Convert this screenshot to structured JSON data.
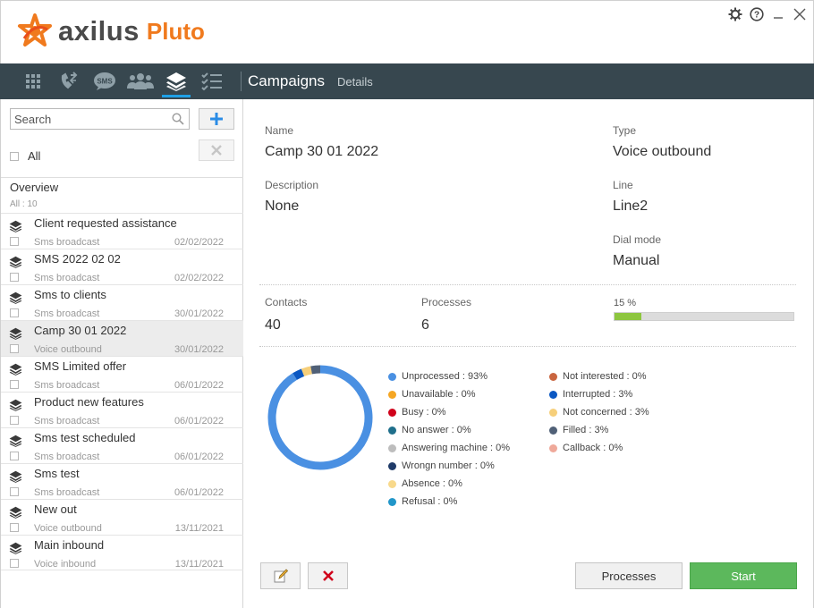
{
  "app": {
    "brand": "axilus",
    "product": "Pluto",
    "colors": {
      "brand_orange": "#f07a1e",
      "toolbar_bg": "#37474f",
      "accent_blue": "#1ea0e6",
      "start_green": "#5cb85c"
    }
  },
  "window_controls": [
    {
      "icon": "gear-icon"
    },
    {
      "icon": "help-icon"
    },
    {
      "icon": "minimize-icon"
    },
    {
      "icon": "close-icon"
    }
  ],
  "toolbar": {
    "tools": [
      {
        "icon": "grid-icon"
      },
      {
        "icon": "call-transfer-icon"
      },
      {
        "icon": "sms-icon"
      },
      {
        "icon": "users-icon"
      },
      {
        "icon": "layers-icon",
        "active": true
      },
      {
        "icon": "checklist-icon"
      }
    ],
    "title": "Campaigns",
    "subtitle": "Details"
  },
  "sidebar": {
    "search_placeholder": "Search",
    "all_label": "All",
    "overview_title": "Overview",
    "overview_count": "All : 10",
    "items": [
      {
        "name": "Client requested assistance",
        "type": "Sms broadcast",
        "date": "02/02/2022"
      },
      {
        "name": "SMS 2022 02 02",
        "type": "Sms broadcast",
        "date": "02/02/2022"
      },
      {
        "name": "Sms to clients",
        "type": "Sms broadcast",
        "date": "30/01/2022"
      },
      {
        "name": "Camp 30 01 2022",
        "type": "Voice outbound",
        "date": "30/01/2022",
        "selected": true
      },
      {
        "name": "SMS Limited offer",
        "type": "Sms broadcast",
        "date": "06/01/2022"
      },
      {
        "name": "Product new features",
        "type": "Sms broadcast",
        "date": "06/01/2022"
      },
      {
        "name": "Sms test scheduled",
        "type": "Sms broadcast",
        "date": "06/01/2022"
      },
      {
        "name": "Sms test",
        "type": "Sms broadcast",
        "date": "06/01/2022"
      },
      {
        "name": "New out",
        "type": "Voice outbound",
        "date": "13/11/2021"
      },
      {
        "name": "Main inbound",
        "type": "Voice inbound",
        "date": "13/11/2021"
      }
    ]
  },
  "details": {
    "name_label": "Name",
    "name_value": "Camp 30 01 2022",
    "type_label": "Type",
    "type_value": "Voice outbound",
    "description_label": "Description",
    "description_value": "None",
    "line_label": "Line",
    "line_value": "Line2",
    "dial_mode_label": "Dial mode",
    "dial_mode_value": "Manual",
    "contacts_label": "Contacts",
    "contacts_value": "40",
    "processes_label": "Processes",
    "processes_value": "6",
    "progress_text": "15 %",
    "progress_fraction": 0.15
  },
  "chart_data": {
    "type": "pie",
    "categories": [
      "Unprocessed",
      "Unavailable",
      "Busy",
      "No answer",
      "Answering machine",
      "Wrongn number",
      "Absence",
      "Refusal",
      "Not interested",
      "Interrupted",
      "Not concerned",
      "Filled",
      "Callback"
    ],
    "values": [
      93,
      0,
      0,
      0,
      0,
      0,
      0,
      0,
      0,
      3,
      3,
      3,
      0
    ],
    "colors": [
      "#4a90e2",
      "#f5a623",
      "#d0021b",
      "#1f6f8b",
      "#bdbdbd",
      "#1f3a68",
      "#f8d98b",
      "#2196c9",
      "#c9653f",
      "#0a57c2",
      "#f6cf7a",
      "#506077",
      "#efa99a"
    ],
    "legend_left": [
      "Unprocessed : 93%",
      "Unavailable : 0%",
      "Busy : 0%",
      "No answer : 0%",
      "Answering machine : 0%",
      "Wrongn number : 0%",
      "Absence : 0%",
      "Refusal : 0%"
    ],
    "legend_right": [
      "Not interested : 0%",
      "Interrupted : 3%",
      "Not concerned : 3%",
      "Filled : 3%",
      "Callback : 0%"
    ]
  },
  "actions": {
    "edit_icon": "edit-icon",
    "delete_icon": "delete-icon",
    "processes_label": "Processes",
    "start_label": "Start"
  }
}
